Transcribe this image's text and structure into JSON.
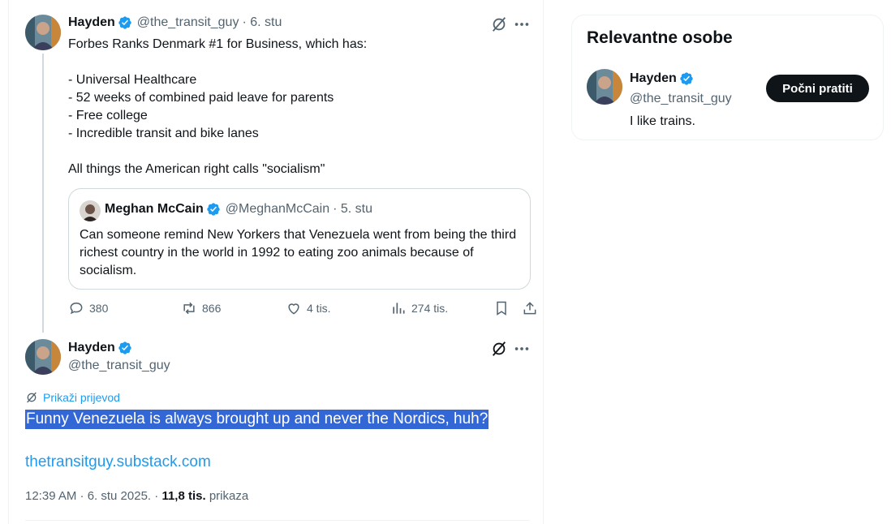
{
  "colors": {
    "accent": "#1d9bf0",
    "text": "#0f1419",
    "muted": "#536471",
    "border": "#cfd9de",
    "selection": "#3367d6"
  },
  "parent_tweet": {
    "name": "Hayden",
    "handle": "@the_transit_guy",
    "date": "· 6. stu",
    "text": "Forbes Ranks Denmark #1 for Business, which has:\n\n- Universal Healthcare\n- 52 weeks of combined paid leave for parents\n- Free college\n- Incredible transit and bike lanes\n\nAll things the American right calls \"socialism\"",
    "quote": {
      "name": "Meghan McCain",
      "handle": "@MeghanMcCain",
      "date": "· 5. stu",
      "text": "Can someone remind New Yorkers that Venezuela went from being the third richest country in the world in 1992 to eating zoo animals because of socialism."
    },
    "stats": {
      "replies": "380",
      "reposts": "866",
      "likes": "4 tis.",
      "views": "274 tis."
    }
  },
  "main_tweet": {
    "name": "Hayden",
    "handle": "@the_transit_guy",
    "translate_label": "Prikaži prijevod",
    "text": "Funny Venezuela is always brought up and never the Nordics, huh?",
    "link": "thetransitguy.substack.com",
    "timestamp": "12:39 AM · 6. stu 2025. ·",
    "views_count": "11,8 tis.",
    "views_label": "prikaza"
  },
  "sidebar": {
    "title": "Relevantne osobe",
    "person": {
      "name": "Hayden",
      "handle": "@the_transit_guy",
      "bio": "I like trains.",
      "follow_label": "Počni pratiti"
    }
  }
}
